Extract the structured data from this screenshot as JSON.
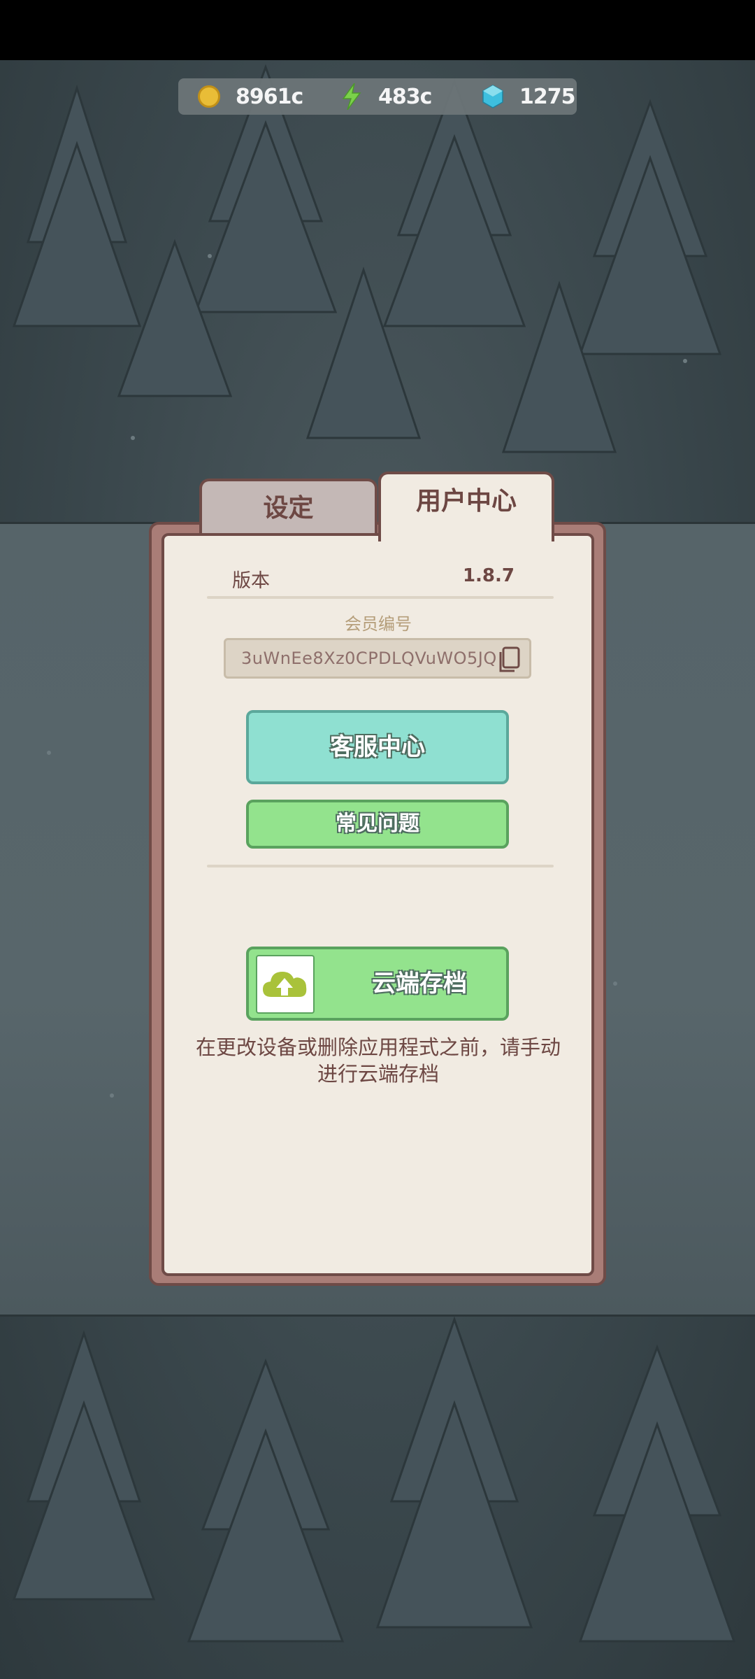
{
  "currencies": [
    {
      "icon": "coin-icon",
      "value": "8961c"
    },
    {
      "icon": "energy-icon",
      "value": "483c"
    },
    {
      "icon": "gem-icon",
      "value": "1275"
    }
  ],
  "tabs": {
    "settings": "设定",
    "user_center": "用户中心"
  },
  "version": {
    "label": "版本",
    "value": "1.8.7"
  },
  "member": {
    "label": "会员编号",
    "id": "3uWnEe8Xz0CPDLQVuWO5JQ"
  },
  "buttons": {
    "customer_service": "客服中心",
    "faq": "常见问题",
    "cloud_save": "云端存档"
  },
  "notice": "在更改设备或删除应用程式之前，请手动进行云端存档",
  "colors": {
    "panel_border": "#6f4b47",
    "panel_bg": "#f1ebe2",
    "service_button": "#8fe0d1",
    "green_button": "#93e38d",
    "cloud_icon": "#a9c23a"
  }
}
